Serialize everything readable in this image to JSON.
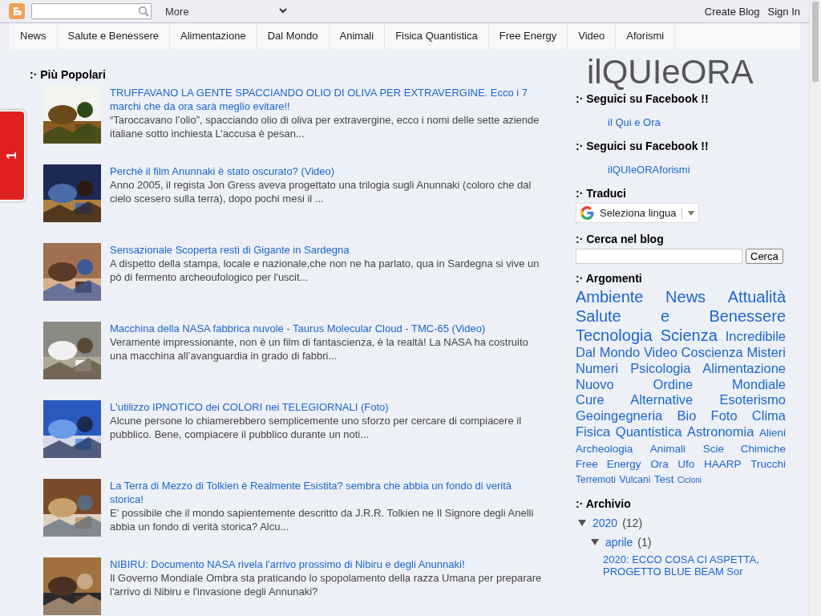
{
  "top_bar": {
    "more_label": "More",
    "links": [
      "Create Blog",
      "Sign In"
    ]
  },
  "menu": [
    "News",
    "Salute e Benessere",
    "Alimentazione",
    "Dal Mondo",
    "Animali",
    "Fisica Quantistica",
    "Free Energy",
    "Video",
    "Aforismi"
  ],
  "side_tab": {
    "count": "1"
  },
  "popular": {
    "heading": ":· Più Popolari",
    "posts": [
      {
        "title": "TRUFFAVANO LA GENTE SPACCIANDO OLIO DI OLIVA PER EXTRAVERGINE. Ecco i 7 marchi che da ora sarà meglio evitare!!",
        "snippet": "“Taroccavano l’olio”, spacciando olio di oliva per extravergine, ecco i nomi delle sette aziende italiane sotto inchiesta L’accusa è pesan..."
      },
      {
        "title": "Perchè il film Anunnaki è stato oscurato? (Video)",
        "snippet": "Anno 2005, il regista Jon Gress aveva progettato una trilogia sugli Anunnaki (coloro che dal cielo scesero sulla terra), dopo pochi mesi il ..."
      },
      {
        "title": "Sensazionale Scoperta resti di Gigante in Sardegna",
        "snippet": "A dispetto della stampa, locale e nazionale,che non ne ha parlato, qua in Sardegna si vive un pò di fermento archeoufologico per l'uscit..."
      },
      {
        "title": "Macchina della NASA fabbrica nuvole - Taurus Molecular Cloud - TMC-65 (Video)",
        "snippet": "Veramente impressionante, non è un film di fantascienza, è la realtà! La NASA ha costruito una macchina all’avanguardia in grado di fabbri..."
      },
      {
        "title": "L'utilizzo IPNOTICO dei COLORI nei TELEGIORNALI (Foto)",
        "snippet": "Alcune persone lo chiamerebbero semplicemente uno sforzo per cercare di compiacere il pubblico. Bene, compiacere il pubblico durante un noti..."
      },
      {
        "title": "La Terra di Mezzo di Tolkien è Realmente Esistita? sembra che abbia un fondo di verità storica!",
        "snippet": "E' possibile che il mondo sapientemente descritto da J.R.R. Tolkien ne Il Signore degli Anelli abbia un fondo di verità storica? Alcu..."
      },
      {
        "title": "NIBIRU: Documento NASA rivela l'arrivo prossimo di Nibiru e degli Anunnaki!",
        "snippet": "Il Governo Mondiale Ombra sta praticando lo spopolamento della razza Umana per preparare l'arrivo di Nibiru e l'invasione degli Annunaki?"
      }
    ]
  },
  "sidebar": {
    "blog_title": "ilQUIeORA",
    "facebook": [
      {
        "heading": ":· Seguici su Facebook !!",
        "link": "il Qui e Ora"
      },
      {
        "heading": ":· Seguici su Facebook !!",
        "link": "ilQUIeORAforismi"
      }
    ],
    "translate": {
      "heading": ":· Traduci",
      "label": "Seleziona lingua"
    },
    "search": {
      "heading": ":· Cerca nel blog",
      "button": "Cerca"
    },
    "labels": {
      "heading": ":· Argomenti",
      "tags": [
        {
          "name": "Ambiente",
          "kind": "xl"
        },
        {
          "name": "News",
          "kind": "xl"
        },
        {
          "name": "Attualità",
          "kind": "xl"
        },
        {
          "name": "Salute e Benessere",
          "kind": "xl"
        },
        {
          "name": "Tecnologia",
          "kind": "xl"
        },
        {
          "name": "Scienza",
          "kind": "xl"
        },
        {
          "name": "Incredibile",
          "kind": "l"
        },
        {
          "name": "Dal Mondo",
          "kind": "l"
        },
        {
          "name": "Video",
          "kind": "l"
        },
        {
          "name": "Coscienza",
          "kind": "l"
        },
        {
          "name": "Misteri",
          "kind": "l"
        },
        {
          "name": "Numeri",
          "kind": "l"
        },
        {
          "name": "Psicologia",
          "kind": "l"
        },
        {
          "name": "Alimentazione",
          "kind": "l"
        },
        {
          "name": "Nuovo Ordine Mondiale",
          "kind": "l"
        },
        {
          "name": "Cure Alternative",
          "kind": "l"
        },
        {
          "name": "Esoterismo",
          "kind": "l"
        },
        {
          "name": "Geoingegneria",
          "kind": "l"
        },
        {
          "name": "Bio",
          "kind": "l"
        },
        {
          "name": "Foto",
          "kind": "l"
        },
        {
          "name": "Clima",
          "kind": "l"
        },
        {
          "name": "Fisica Quantistica",
          "kind": "l"
        },
        {
          "name": "Astronomia",
          "kind": "l"
        },
        {
          "name": "Alieni",
          "kind": "m"
        },
        {
          "name": "Archeologia",
          "kind": "m"
        },
        {
          "name": "Animali",
          "kind": "m"
        },
        {
          "name": "Scie Chimiche",
          "kind": "m"
        },
        {
          "name": "Free Energy",
          "kind": "m"
        },
        {
          "name": "Ora",
          "kind": "m"
        },
        {
          "name": "Ufo",
          "kind": "m"
        },
        {
          "name": "HAARP",
          "kind": "m"
        },
        {
          "name": "Trucchi",
          "kind": "m"
        },
        {
          "name": "Terremoti",
          "kind": "s"
        },
        {
          "name": "Vulcani",
          "kind": "s"
        },
        {
          "name": "Test",
          "kind": "m"
        },
        {
          "name": "Cicloni",
          "kind": "xs"
        }
      ]
    },
    "archive": {
      "heading": ":· Archivio",
      "years": [
        {
          "label": "2020",
          "count": "(12)",
          "expanded": true,
          "children": [
            {
              "label": "aprile",
              "count": "(1)",
              "expanded": true,
              "children": [
                {
                  "label": "2020: ECCO COSA CI ASPETTA, PROGETTO BLUE BEAM Sor"
                }
              ]
            }
          ]
        }
      ]
    }
  }
}
